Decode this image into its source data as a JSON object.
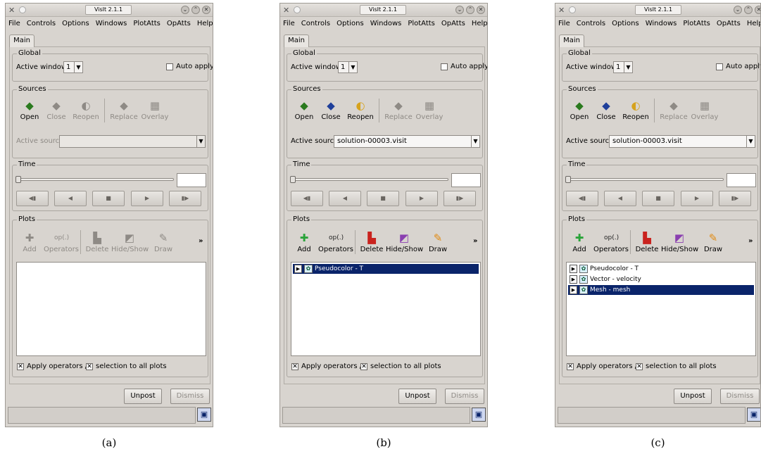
{
  "window": {
    "title": "VisIt 2.1.1",
    "menus": [
      "File",
      "Controls",
      "Options",
      "Windows",
      "PlotAtts",
      "OpAtts",
      "Help"
    ],
    "tab": "Main"
  },
  "global": {
    "title": "Global",
    "active_window_label": "Active window",
    "active_window_value": "1",
    "auto_apply": "Auto apply"
  },
  "sources": {
    "title": "Sources",
    "buttons": [
      "Open",
      "Close",
      "Reopen",
      "Replace",
      "Overlay"
    ],
    "active_source_label": "Active source"
  },
  "time": {
    "title": "Time"
  },
  "plots": {
    "title": "Plots",
    "buttons": [
      "Add",
      "Operators",
      "Delete",
      "Hide/Show",
      "Draw"
    ],
    "op_icon_text": "op(.)",
    "more_glyph": "»",
    "apply_operators": "Apply operators  /",
    "selection_all": "selection to all plots"
  },
  "footer": {
    "unpost": "Unpost",
    "dismiss": "Dismiss"
  },
  "panels": [
    {
      "caption": "(a)",
      "active_source": "",
      "plots": []
    },
    {
      "caption": "(b)",
      "active_source": "solution-00003.visit",
      "plots": [
        {
          "label": "Pseudocolor - T",
          "selected": true
        }
      ]
    },
    {
      "caption": "(c)",
      "active_source": "solution-00003.visit",
      "plots": [
        {
          "label": "Pseudocolor - T",
          "selected": false
        },
        {
          "label": "Vector - velocity",
          "selected": false
        },
        {
          "label": "Mesh - mesh",
          "selected": true
        }
      ]
    }
  ],
  "colors": {
    "selection": "#0a246a",
    "panel_bg": "#d8d4cf"
  }
}
